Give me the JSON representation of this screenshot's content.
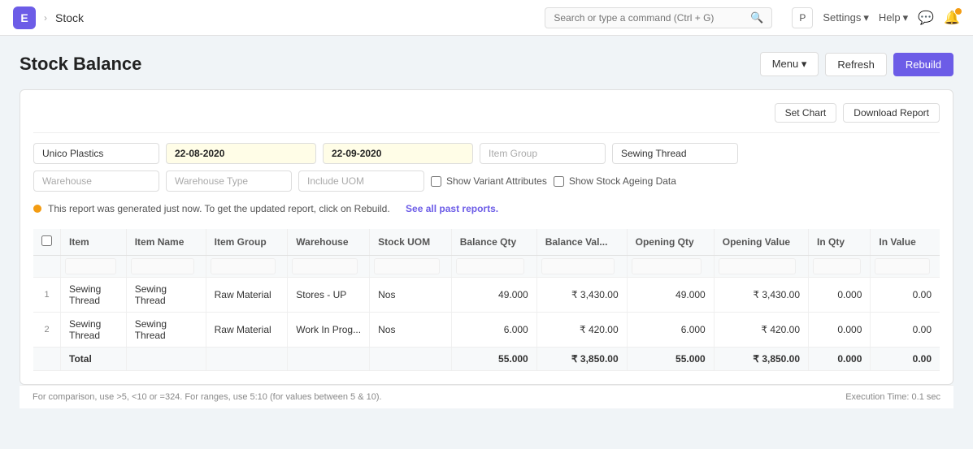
{
  "navbar": {
    "app_icon": "E",
    "breadcrumb_arrow": "›",
    "page_name": "Stock",
    "search_placeholder": "Search or type a command (Ctrl + G)",
    "p_label": "P",
    "settings_label": "Settings",
    "help_label": "Help"
  },
  "page": {
    "title": "Stock Balance",
    "menu_label": "Menu",
    "refresh_label": "Refresh",
    "rebuild_label": "Rebuild"
  },
  "toolbar": {
    "set_chart_label": "Set Chart",
    "download_report_label": "Download Report"
  },
  "filters": {
    "company": "Unico Plastics",
    "date_from": "22-08-2020",
    "date_to": "22-09-2020",
    "item_group_placeholder": "Item Group",
    "item_group_value": "",
    "item_name_value": "Sewing Thread",
    "warehouse_placeholder": "Warehouse",
    "warehouse_type_placeholder": "Warehouse Type",
    "include_uom_placeholder": "Include UOM",
    "show_variant_label": "Show Variant Attributes",
    "show_ageing_label": "Show Stock Ageing Data"
  },
  "alert": {
    "message": "This report was generated just now. To get the updated report, click on Rebuild.",
    "link_text": "See all past reports."
  },
  "table": {
    "columns": [
      "",
      "Item",
      "Item Name",
      "Item Group",
      "Warehouse",
      "Stock UOM",
      "Balance Qty",
      "Balance Val...",
      "Opening Qty",
      "Opening Value",
      "In Qty",
      "In Value"
    ],
    "filter_cells": [
      "",
      "",
      "",
      "",
      "",
      "",
      "",
      "",
      "",
      "",
      "",
      ""
    ],
    "rows": [
      {
        "index": "1",
        "item": "Sewing Thread",
        "item_name": "Sewing Thread",
        "item_group": "Raw Material",
        "warehouse": "Stores - UP",
        "stock_uom": "Nos",
        "balance_qty": "49.000",
        "balance_val": "₹ 3,430.00",
        "opening_qty": "49.000",
        "opening_value": "₹ 3,430.00",
        "in_qty": "0.000",
        "in_value": "0.00"
      },
      {
        "index": "2",
        "item": "Sewing Thread",
        "item_name": "Sewing Thread",
        "item_group": "Raw Material",
        "warehouse": "Work In Prog...",
        "stock_uom": "Nos",
        "balance_qty": "6.000",
        "balance_val": "₹ 420.00",
        "opening_qty": "6.000",
        "opening_value": "₹ 420.00",
        "in_qty": "0.000",
        "in_value": "0.00"
      }
    ],
    "total_row": {
      "label": "Total",
      "balance_qty": "55.000",
      "balance_val": "₹ 3,850.00",
      "opening_qty": "55.000",
      "opening_value": "₹ 3,850.00",
      "in_qty": "0.000",
      "in_value": "0.00"
    }
  },
  "footer": {
    "hint": "For comparison, use >5, <10 or =324. For ranges, use 5:10 (for values between 5 & 10).",
    "execution_time": "Execution Time: 0.1 sec"
  }
}
